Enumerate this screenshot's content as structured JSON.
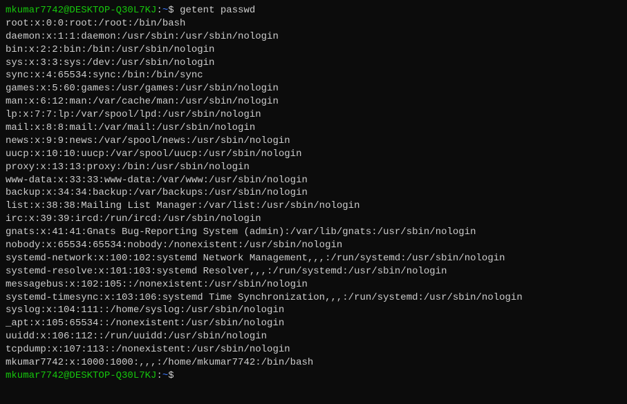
{
  "prompt": {
    "user": "mkumar7742",
    "at": "@",
    "host": "DESKTOP-Q30L7KJ",
    "colon": ":",
    "path": "~",
    "symbol": "$"
  },
  "command": "getent passwd",
  "output_lines": [
    "root:x:0:0:root:/root:/bin/bash",
    "daemon:x:1:1:daemon:/usr/sbin:/usr/sbin/nologin",
    "bin:x:2:2:bin:/bin:/usr/sbin/nologin",
    "sys:x:3:3:sys:/dev:/usr/sbin/nologin",
    "sync:x:4:65534:sync:/bin:/bin/sync",
    "games:x:5:60:games:/usr/games:/usr/sbin/nologin",
    "man:x:6:12:man:/var/cache/man:/usr/sbin/nologin",
    "lp:x:7:7:lp:/var/spool/lpd:/usr/sbin/nologin",
    "mail:x:8:8:mail:/var/mail:/usr/sbin/nologin",
    "news:x:9:9:news:/var/spool/news:/usr/sbin/nologin",
    "uucp:x:10:10:uucp:/var/spool/uucp:/usr/sbin/nologin",
    "proxy:x:13:13:proxy:/bin:/usr/sbin/nologin",
    "www-data:x:33:33:www-data:/var/www:/usr/sbin/nologin",
    "backup:x:34:34:backup:/var/backups:/usr/sbin/nologin",
    "list:x:38:38:Mailing List Manager:/var/list:/usr/sbin/nologin",
    "irc:x:39:39:ircd:/run/ircd:/usr/sbin/nologin",
    "gnats:x:41:41:Gnats Bug-Reporting System (admin):/var/lib/gnats:/usr/sbin/nologin",
    "nobody:x:65534:65534:nobody:/nonexistent:/usr/sbin/nologin",
    "systemd-network:x:100:102:systemd Network Management,,,:/run/systemd:/usr/sbin/nologin",
    "systemd-resolve:x:101:103:systemd Resolver,,,:/run/systemd:/usr/sbin/nologin",
    "messagebus:x:102:105::/nonexistent:/usr/sbin/nologin",
    "systemd-timesync:x:103:106:systemd Time Synchronization,,,:/run/systemd:/usr/sbin/nologin",
    "syslog:x:104:111::/home/syslog:/usr/sbin/nologin",
    "_apt:x:105:65534::/nonexistent:/usr/sbin/nologin",
    "uuidd:x:106:112::/run/uuidd:/usr/sbin/nologin",
    "tcpdump:x:107:113::/nonexistent:/usr/sbin/nologin",
    "mkumar7742:x:1000:1000:,,,:/home/mkumar7742:/bin/bash"
  ]
}
